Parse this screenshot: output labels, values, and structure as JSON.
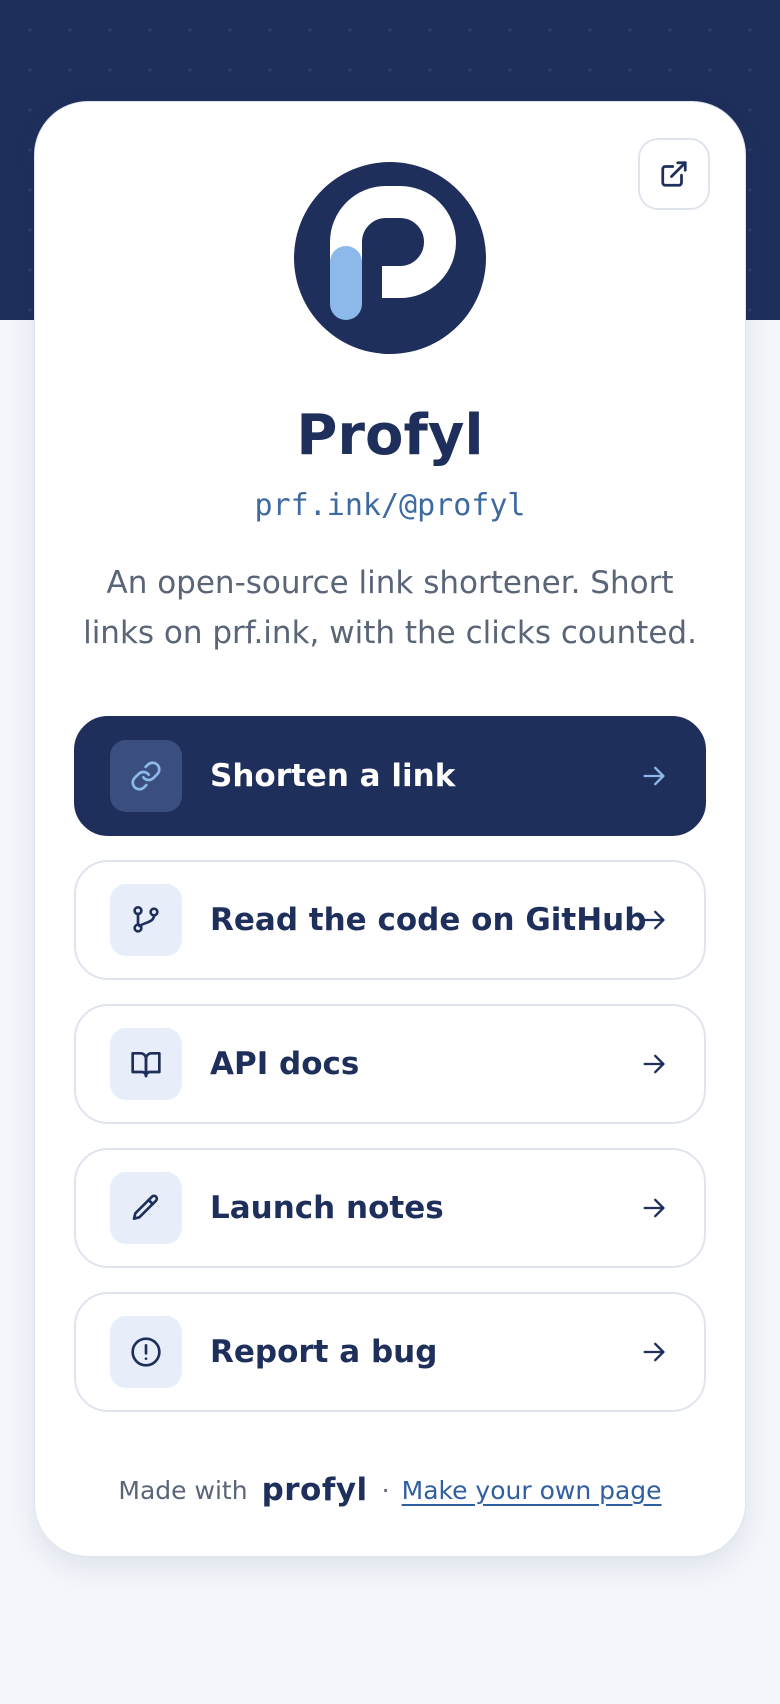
{
  "profile": {
    "name": "Profyl",
    "handle": "prf.ink/@profyl",
    "bio": "An open-source link shortener. Short links on prf.ink, with the clicks counted.",
    "avatar_icon": "profyl-logo-icon",
    "avatar_bg": "#1f2f5c",
    "avatar_accent": "#8cb8ea"
  },
  "share": {
    "icon": "share-external-icon"
  },
  "links": [
    {
      "label": "Shorten a link",
      "icon": "link-icon",
      "primary": true
    },
    {
      "label": "Read the code on GitHub",
      "icon": "git-branch-icon",
      "primary": false
    },
    {
      "label": "API docs",
      "icon": "book-icon",
      "primary": false
    },
    {
      "label": "Launch notes",
      "icon": "pencil-icon",
      "primary": false
    },
    {
      "label": "Report a bug",
      "icon": "alert-circle-icon",
      "primary": false
    }
  ],
  "footer": {
    "made_with": "Made with",
    "brand": "profyl",
    "separator": "·",
    "cta": "Make your own page"
  },
  "colors": {
    "navy": "#1f2f5c",
    "accent_light": "#8cb8ea",
    "link_blue": "#2f5fa0",
    "page_bg": "#f4f6fb"
  }
}
